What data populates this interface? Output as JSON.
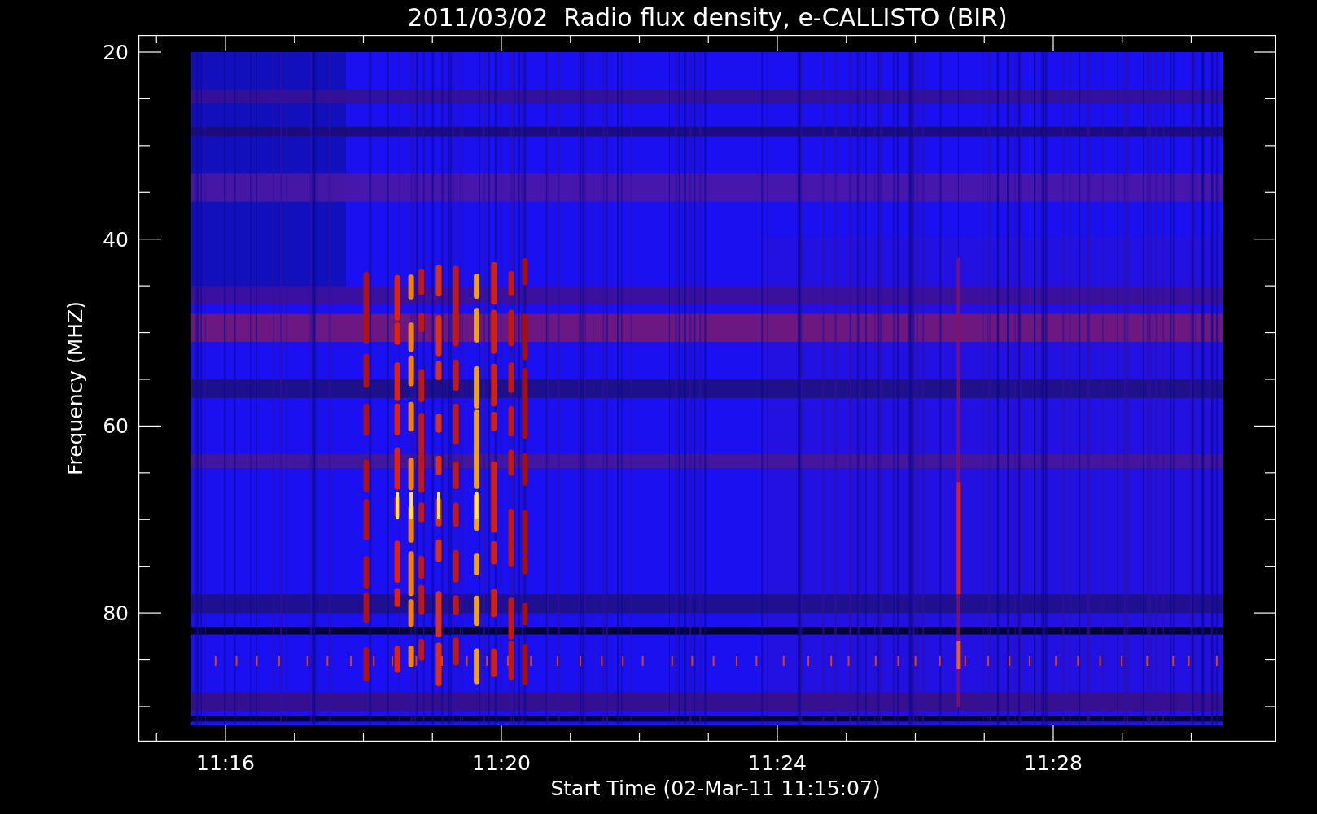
{
  "plot": {
    "title": "2011/03/02  Radio flux density, e-CALLISTO (BIR)",
    "x_axis": {
      "label": "Start Time (02-Mar-11 11:15:07)",
      "tick_labels": [
        "11:16",
        "11:20",
        "11:24",
        "11:28"
      ]
    },
    "y_axis": {
      "label": "Frequency (MHZ)",
      "tick_labels": [
        "20",
        "40",
        "60",
        "80"
      ]
    }
  }
}
